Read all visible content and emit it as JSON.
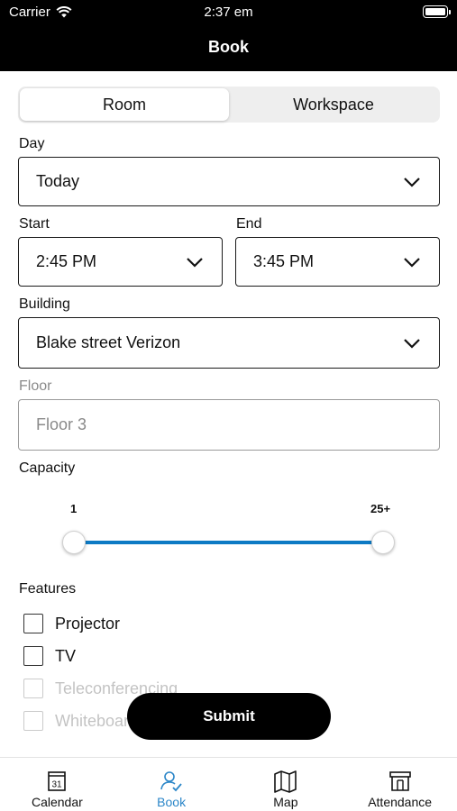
{
  "status": {
    "carrier": "Carrier",
    "time": "2:37 em"
  },
  "nav": {
    "title": "Book"
  },
  "segments": [
    {
      "label": "Room",
      "selected": true
    },
    {
      "label": "Workspace",
      "selected": false
    }
  ],
  "form": {
    "day": {
      "label": "Day",
      "value": "Today"
    },
    "start": {
      "label": "Start",
      "value": "2:45 PM"
    },
    "end": {
      "label": "End",
      "value": "3:45 PM"
    },
    "building": {
      "label": "Building",
      "value": "Blake street Verizon"
    },
    "floor": {
      "label": "Floor",
      "placeholder": "Floor 3"
    },
    "capacity": {
      "label": "Capacity",
      "min_label": "1",
      "max_label": "25+",
      "min_fraction": 0.0,
      "max_fraction": 1.0
    }
  },
  "features": {
    "label": "Features",
    "items": [
      {
        "label": "Projector",
        "checked": false
      },
      {
        "label": "TV",
        "checked": false
      },
      {
        "label": "Teleconferencing",
        "checked": false
      },
      {
        "label": "Whiteboard",
        "checked": false
      }
    ]
  },
  "submit_label": "Submit",
  "tabs": [
    {
      "label": "Calendar",
      "icon": "calendar-icon",
      "icon_text": "31",
      "active": false
    },
    {
      "label": "Book",
      "icon": "person-check-icon",
      "active": true
    },
    {
      "label": "Map",
      "icon": "map-icon",
      "active": false
    },
    {
      "label": "Attendance",
      "icon": "building-icon",
      "active": false
    }
  ],
  "colors": {
    "accent": "#2b86c8",
    "slider": "#0d7ac4",
    "nav_bg": "#000000"
  }
}
